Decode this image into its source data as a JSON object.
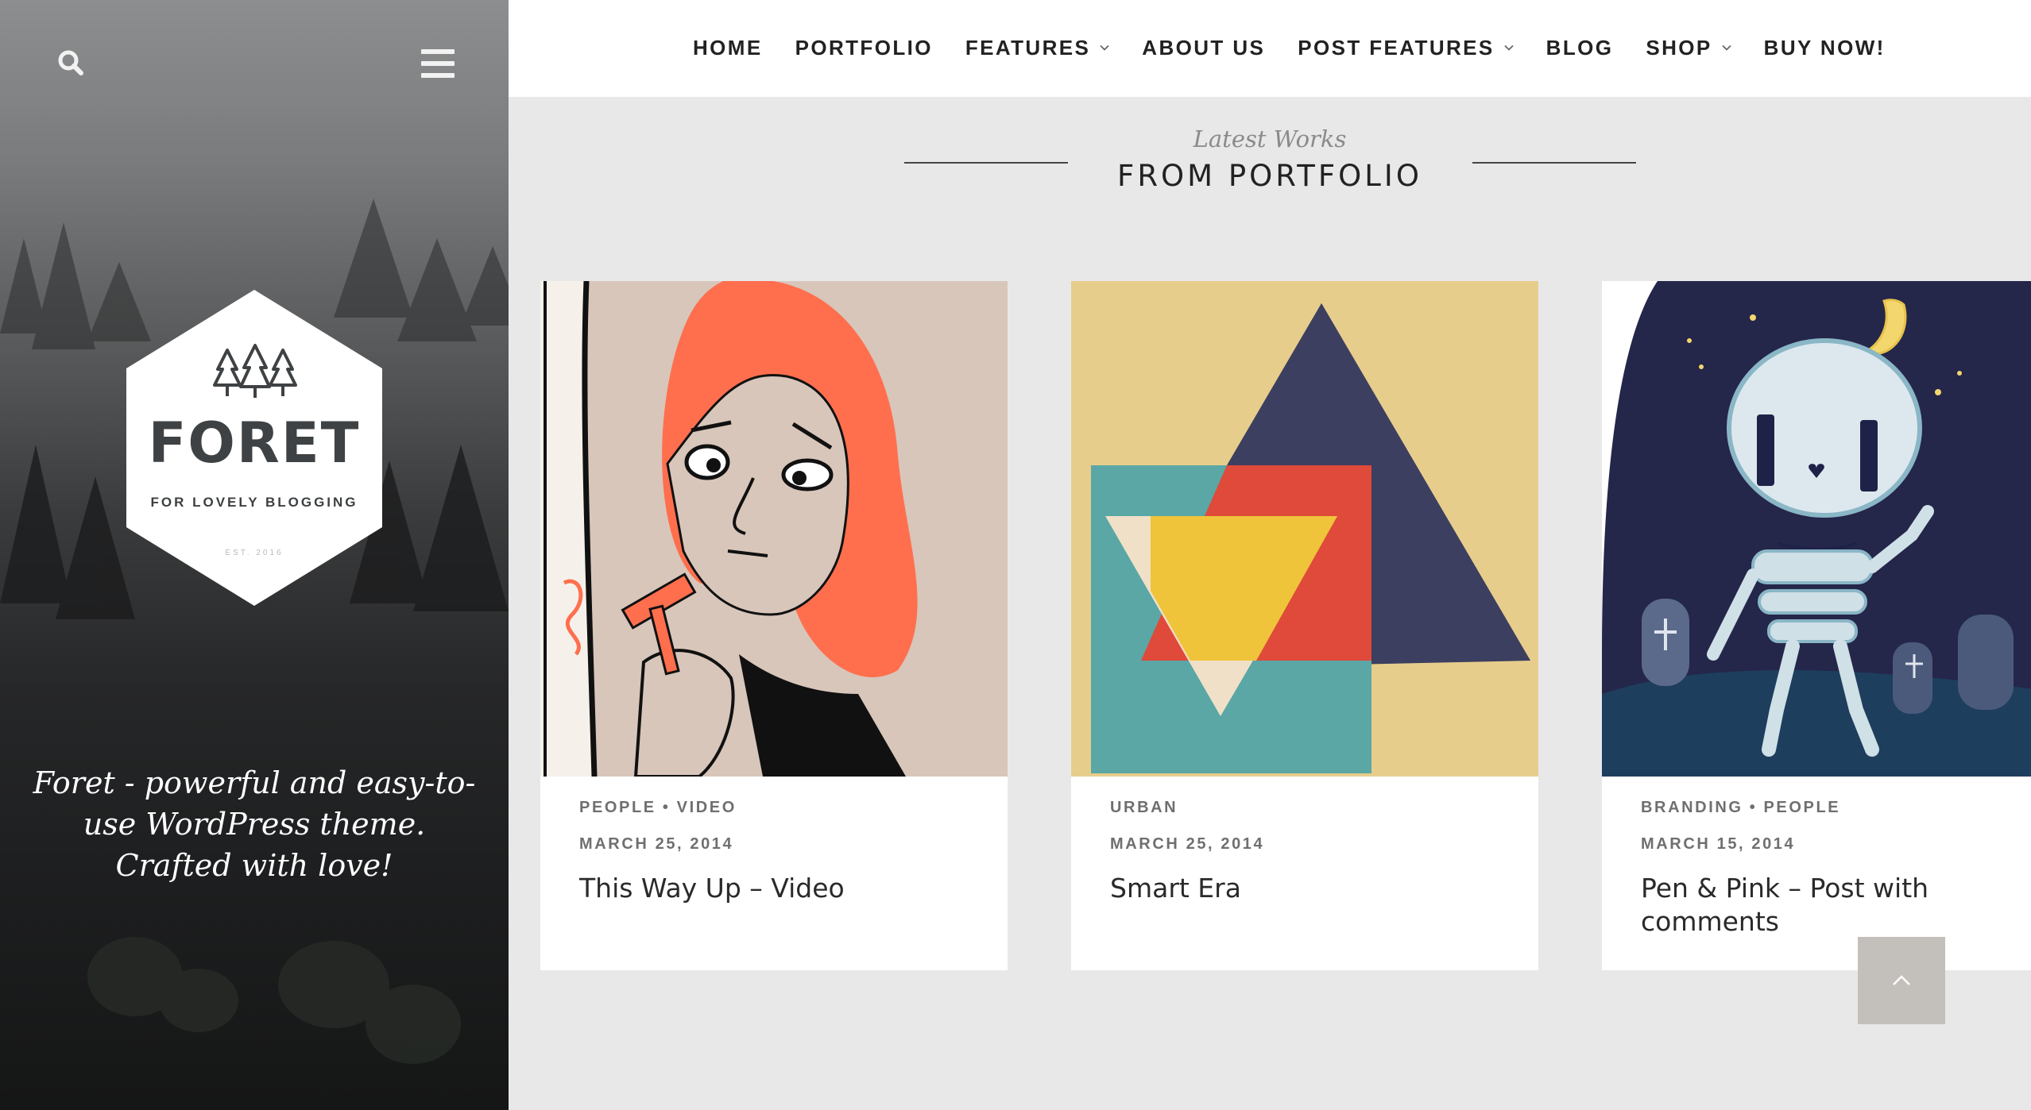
{
  "sidebar": {
    "logo": {
      "name": "FORET",
      "tagline": "FOR LOVELY BLOGGING",
      "est": "EST. 2016"
    },
    "description": "Foret - powerful and easy-to-use WordPress theme. Crafted with love!",
    "icons": {
      "search": "search-icon",
      "menu": "hamburger-menu-icon"
    }
  },
  "nav": {
    "items": [
      {
        "label": "HOME",
        "dropdown": false
      },
      {
        "label": "PORTFOLIO",
        "dropdown": false
      },
      {
        "label": "FEATURES",
        "dropdown": true
      },
      {
        "label": "ABOUT US",
        "dropdown": false
      },
      {
        "label": "POST FEATURES",
        "dropdown": true
      },
      {
        "label": "BLOG",
        "dropdown": false
      },
      {
        "label": "SHOP",
        "dropdown": true
      },
      {
        "label": "BUY NOW!",
        "dropdown": false
      }
    ]
  },
  "section": {
    "kicker": "Latest Works",
    "title": "FROM PORTFOLIO"
  },
  "cards": [
    {
      "categories": "PEOPLE • VIDEO",
      "date": "MARCH 25, 2014",
      "title": "This Way Up – Video",
      "image": "girl-illustration"
    },
    {
      "categories": "URBAN",
      "date": "MARCH 25, 2014",
      "title": "Smart Era",
      "image": "geometric-shapes"
    },
    {
      "categories": "BRANDING • PEOPLE",
      "date": "MARCH 15, 2014",
      "title": "Pen & Pink – Post with comments",
      "image": "skeleton-night"
    }
  ],
  "colors": {
    "accent_orange": "#ff6f4e",
    "dark_navy": "#292b45",
    "sand": "#e7cd8c",
    "back_to_top_bg": "#c3c0bb"
  }
}
